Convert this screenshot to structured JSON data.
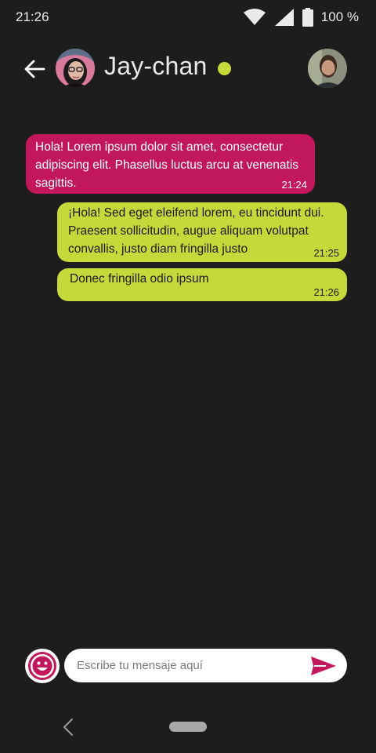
{
  "status_bar": {
    "time": "21:26",
    "battery": "100 %",
    "icons": [
      "wifi-icon",
      "signal-icon",
      "battery-icon"
    ]
  },
  "header": {
    "contact_name": "Jay-chan",
    "online_status_color": "#c6d93a",
    "icons": [
      "back-arrow-icon",
      "contact-avatar",
      "user-avatar"
    ]
  },
  "messages": [
    {
      "direction": "incoming",
      "text": "Hola! Lorem ipsum dolor sit amet, consectetur adipiscing elit. Phasellus luctus arcu at venenatis sagittis.",
      "time": "21:24",
      "color": "#c2185b"
    },
    {
      "direction": "outgoing",
      "text": "¡Hola! Sed eget eleifend lorem, eu tincidunt dui. Praesent sollicitudin, augue aliquam volutpat convallis, justo diam fringilla justo",
      "time": "21:25",
      "color": "#c6d93a"
    },
    {
      "direction": "outgoing",
      "text": "Donec fringilla odio ipsum",
      "time": "21:26",
      "color": "#c6d93a"
    }
  ],
  "composer": {
    "placeholder": "Escribe tu mensaje aquí",
    "value": "",
    "icons": [
      "emoji-icon",
      "send-icon"
    ],
    "accent": "#c2185b"
  },
  "colors": {
    "background": "#1d1d1d",
    "accent_pink": "#c2185b",
    "accent_lime": "#c6d93a"
  }
}
